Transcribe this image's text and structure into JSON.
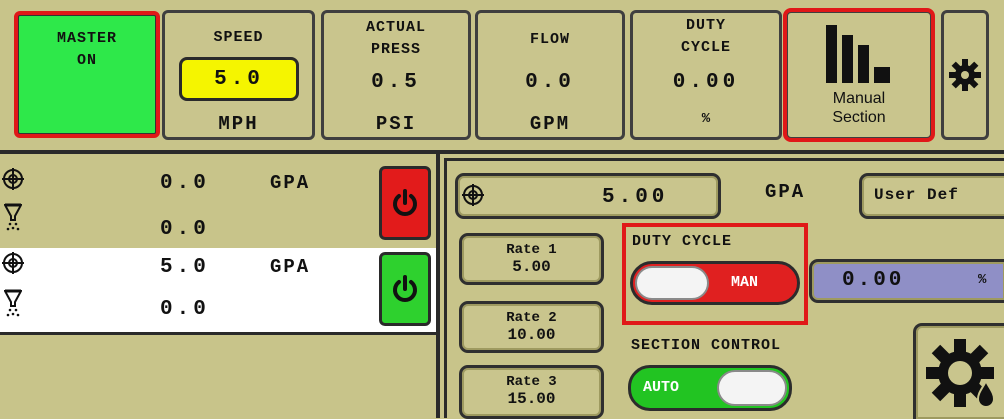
{
  "top_bar": {
    "master": {
      "line1": "MASTER",
      "line2": "ON"
    },
    "speed": {
      "label": "SPEED",
      "value": "5.0",
      "unit": "MPH"
    },
    "actual_press": {
      "line1": "ACTUAL",
      "line2": "PRESS",
      "value": "0.5",
      "unit": "PSI"
    },
    "flow": {
      "label": "FLOW",
      "value": "0.0",
      "unit": "GPM"
    },
    "duty_cycle": {
      "line1": "DUTY",
      "line2": "CYCLE",
      "value": "0.00",
      "unit": "%"
    },
    "manual_section": {
      "line1": "Manual",
      "line2": "Section",
      "icon": "bars-chart-icon"
    },
    "settings_icon": "gear-icon"
  },
  "left_panel": {
    "channels": [
      {
        "rate_value": "0.0",
        "rate_unit": "GPA",
        "flow_value": "0.0",
        "power_state": "off",
        "power_color": "#e21b1b",
        "selected": false
      },
      {
        "rate_value": "5.0",
        "rate_unit": "GPA",
        "flow_value": "0.0",
        "power_state": "on",
        "power_color": "#2ed12e",
        "selected": true
      }
    ]
  },
  "right_panel": {
    "target_rate": {
      "value": "5.00",
      "unit": "GPA"
    },
    "user_def_label": "User Def",
    "rates": [
      {
        "line1": "Rate 1",
        "line2": "5.00"
      },
      {
        "line1": "Rate 2",
        "line2": "10.00"
      },
      {
        "line1": "Rate 3",
        "line2": "15.00"
      }
    ],
    "duty_cycle": {
      "label": "DUTY CYCLE",
      "toggle_text": "MAN",
      "toggle_state": "manual",
      "value": "0.00",
      "unit": "%"
    },
    "section_control": {
      "label": "SECTION CONTROL",
      "toggle_text": "AUTO",
      "toggle_state": "auto"
    },
    "bottom_icon": "gear-droplet-icon"
  },
  "colors": {
    "background": "#c8c48a",
    "master_on": "#2ee84a",
    "speed_field": "#f5f500",
    "highlight": "#e01818",
    "man_toggle": "#e02020",
    "auto_toggle": "#22c422",
    "duty_value_field": "#8f8fc6"
  }
}
